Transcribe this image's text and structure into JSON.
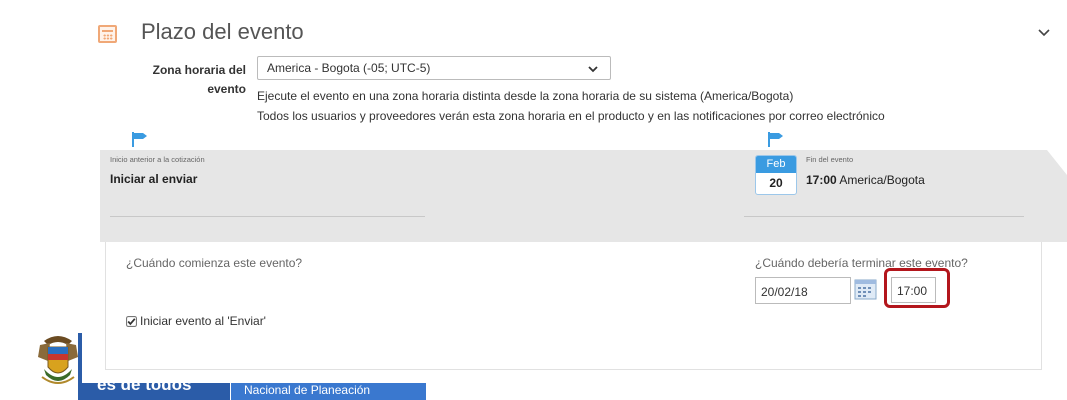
{
  "section": {
    "title": "Plazo del evento",
    "icon": "calendar-icon",
    "collapse_icon": "chevron-down-icon"
  },
  "timezone": {
    "label_line1": "Zona horaria del",
    "label_line2": "evento",
    "selected": "America - Bogota (-05; UTC-5)",
    "note1": "Ejecute el evento en una zona horaria distinta desde la zona horaria de su sistema (America/Bogota)",
    "note2": "Todos los usuarios y proveedores verán esta zona horaria en el producto y en las notificaciones por correo electrónico"
  },
  "timeline": {
    "start_caption": "Inicio anterior a la cotización",
    "start_value": "Iniciar al enviar",
    "end_caption": "Fin del evento",
    "end_month": "Feb",
    "end_day": "20",
    "end_time": "17:00",
    "end_zone": "America/Bogota"
  },
  "form": {
    "start_question": "¿Cuándo comienza este evento?",
    "end_question": "¿Cuándo debería terminar este evento?",
    "end_date": "20/02/18",
    "end_time": "17:00",
    "start_on_send_label": "Iniciar evento al 'Enviar'",
    "start_on_send_checked": true
  },
  "footer": {
    "slogan": "es de todos",
    "entity": "Nacional de Planeación"
  },
  "colors": {
    "accent_blue": "#3a9be1",
    "highlight_red": "#b3161c",
    "band_gray": "#e6e6e6",
    "footer_blue": "#2b5ca8"
  }
}
